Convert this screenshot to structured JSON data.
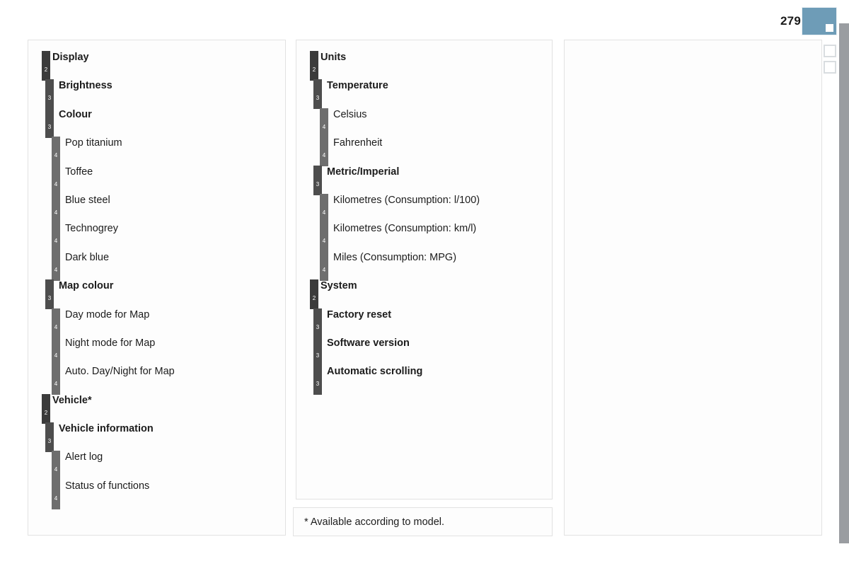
{
  "header": {
    "page_number": "279",
    "tab_active_name": "active-page-tab",
    "accent_color": "#6e9cb7",
    "edge_strip_color": "#9a9da1"
  },
  "columns": [
    {
      "name": "column-left",
      "rows": [
        {
          "level": 2,
          "label": "Display"
        },
        {
          "level": 3,
          "label": "Brightness"
        },
        {
          "level": 3,
          "label": "Colour"
        },
        {
          "level": 4,
          "label": "Pop titanium"
        },
        {
          "level": 4,
          "label": "Toffee"
        },
        {
          "level": 4,
          "label": "Blue steel"
        },
        {
          "level": 4,
          "label": "Technogrey"
        },
        {
          "level": 4,
          "label": "Dark blue"
        },
        {
          "level": 3,
          "label": "Map colour"
        },
        {
          "level": 4,
          "label": "Day mode for Map"
        },
        {
          "level": 4,
          "label": "Night mode for Map"
        },
        {
          "level": 4,
          "label": "Auto. Day/Night for Map"
        },
        {
          "level": 2,
          "label": "Vehicle*"
        },
        {
          "level": 3,
          "label": "Vehicle information"
        },
        {
          "level": 4,
          "label": "Alert log"
        },
        {
          "level": 4,
          "label": "Status of functions"
        }
      ]
    },
    {
      "name": "column-middle",
      "rows": [
        {
          "level": 2,
          "label": "Units"
        },
        {
          "level": 3,
          "label": "Temperature"
        },
        {
          "level": 4,
          "label": "Celsius"
        },
        {
          "level": 4,
          "label": "Fahrenheit"
        },
        {
          "level": 3,
          "label": "Metric/Imperial"
        },
        {
          "level": 4,
          "label": "Kilometres (Consumption: l/100)"
        },
        {
          "level": 4,
          "label": "Kilometres (Consumption: km/l)"
        },
        {
          "level": 4,
          "label": "Miles (Consumption: MPG)"
        },
        {
          "level": 2,
          "label": "System"
        },
        {
          "level": 3,
          "label": "Factory reset"
        },
        {
          "level": 3,
          "label": "Software version"
        },
        {
          "level": 3,
          "label": "Automatic scrolling"
        }
      ]
    },
    {
      "name": "column-right",
      "rows": []
    }
  ],
  "footnote": {
    "text": "* Available according to model."
  }
}
